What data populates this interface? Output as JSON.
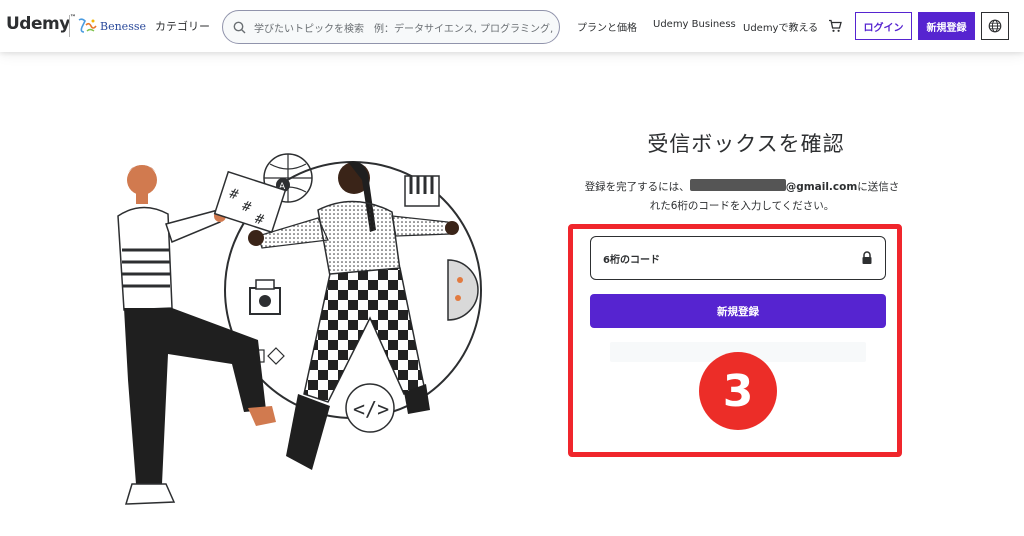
{
  "header": {
    "logo": "Udemy",
    "partner_logo": "Benesse",
    "categories": "カテゴリー",
    "search_placeholder": "学びたいトピックを検索　例：データサイエンス, プログラミング,",
    "links": [
      "プランと価格",
      "Udemy Business",
      "Udemyで教える"
    ],
    "login": "ログイン",
    "signup": "新規登録"
  },
  "main": {
    "title": "受信ボックスを確認",
    "desc_before": "登録を完了するには、",
    "email_suffix": "@gmail.com",
    "desc_after": "に送信された6桁のコードを入力してください。",
    "code_placeholder": "6桁のコード",
    "submit": "新規登録",
    "step_number": "3"
  },
  "colors": {
    "brand_purple": "#5624d0",
    "highlight_red": "#f0262c"
  }
}
